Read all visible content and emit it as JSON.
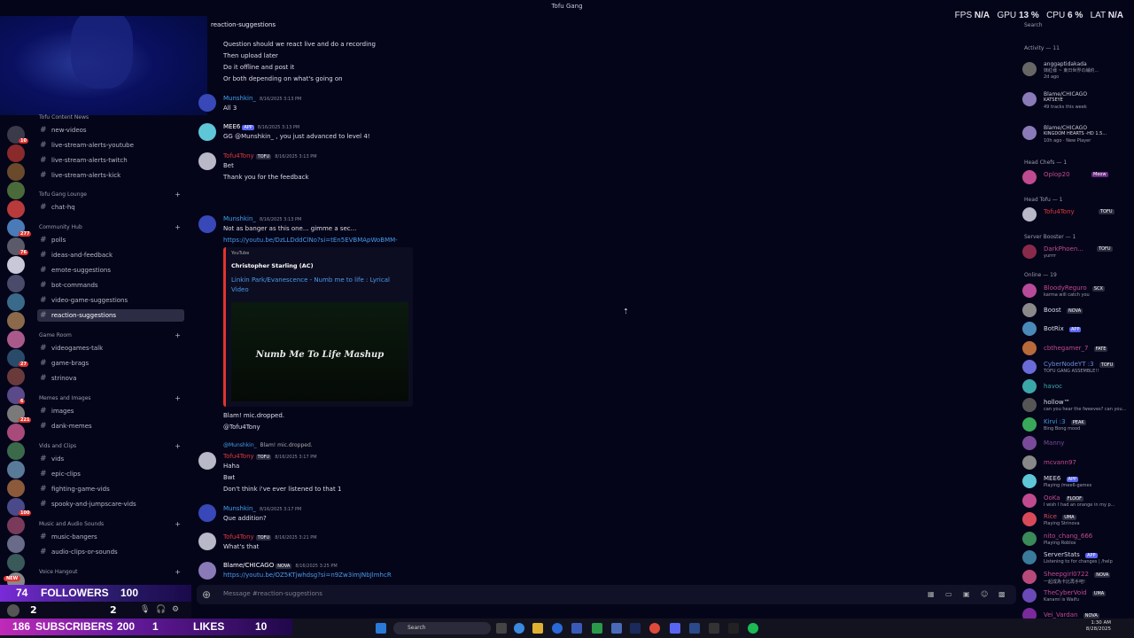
{
  "window": {
    "title": "Tofu Gang"
  },
  "perf": {
    "fps_label": "FPS",
    "fps": "N/A",
    "gpu_label": "GPU",
    "gpu": "13 %",
    "cpu_label": "CPU",
    "cpu": "6 %",
    "lat_label": "LAT",
    "lat": "N/A"
  },
  "search": {
    "placeholder": "Search"
  },
  "channel": {
    "title": "reaction-suggestions",
    "composer_placeholder": "Message #reaction-suggestions"
  },
  "categories": {
    "content_news": "Tofu Content News",
    "lounge": "Tofu Gang Lounge",
    "community": "Community Hub",
    "game_room": "Game Room",
    "memes": "Memes and Images",
    "vids": "Vids and Clips",
    "music": "Music and Audio Sounds",
    "voice": "Voice Hangout"
  },
  "channels": [
    "new-videos",
    "live-stream-alerts-youtube",
    "live-stream-alerts-twitch",
    "live-stream-alerts-kick",
    "chat-hq",
    "polls",
    "ideas-and-feedback",
    "emote-suggestions",
    "bot-commands",
    "video-game-suggestions",
    "reaction-suggestions",
    "videogames-talk",
    "game-brags",
    "strinova",
    "images",
    "dank-memes",
    "vids",
    "epic-clips",
    "fighting-game-vids",
    "spooky-and-jumpscare-vids",
    "music-bangers",
    "audio-clips-or-sounds"
  ],
  "server_badges": [
    "10",
    "",
    "",
    "",
    "",
    "277",
    "76",
    "",
    "",
    "",
    "",
    "",
    "27",
    "",
    "6",
    "221",
    "",
    "",
    "",
    "",
    "100",
    "",
    "",
    "",
    "19"
  ],
  "messages": {
    "pre1": "Question should we react live and do a recording",
    "pre2": "Then upload later",
    "pre3": "Do it offline and post it",
    "pre4": "Or both depending on what's going on",
    "m1_author": "Munshkin_",
    "m1_ts": "8/16/2025 3:13 PM",
    "m1_text": "All 3",
    "m2_author": "MEE6",
    "m2_tag": "APP",
    "m2_ts": "8/16/2025 3:13 PM",
    "m2_text1": "GG @Munshkin_",
    "m2_text2": ", you just advanced to level 4!",
    "m3_author": "Tofu4Tony",
    "m3_tag": "TOFU",
    "m3_ts": "8/16/2025 3:13 PM",
    "m3_text1": "Bet",
    "m3_text2": "Thank you for the feedback",
    "m4_author": "Munshkin_",
    "m4_ts": "8/16/2025 3:13 PM",
    "m4_text": "Not as banger as this one... gimme a sec...",
    "m4_link": "https://youtu.be/DzLLDddClNo?si=tEn5EVBMApWoBMM-",
    "embed_provider": "YouTube",
    "embed_author": "Christopher Starling (AC)",
    "embed_title": "Linkin Park/Evanescence - Numb me to life : Lyrical Video",
    "embed_video_text": "Numb Me To Life Mashup",
    "m4_text2": "Blam! mic.dropped.",
    "m4_text3": "@Tofu4Tony",
    "reply_author": "@Munshkin_",
    "reply_text": "Blam! mic.dropped.",
    "m5_author": "Tofu4Tony",
    "m5_tag": "TOFU",
    "m5_ts": "8/16/2025 3:17 PM",
    "m5_text1": "Haha",
    "m5_text2": "Bwt",
    "m5_text3": "Don't think i've ever listened to that 1",
    "m6_author": "Munshkin_",
    "m6_ts": "8/16/2025 3:17 PM",
    "m6_text": "Que addition?",
    "m7_author": "Tofu4Tony",
    "m7_tag": "TOFU",
    "m7_ts": "8/16/2025 3:21 PM",
    "m7_text": "What's that",
    "m8_author": "Blame/CHICAGO",
    "m8_tag": "NOVA",
    "m8_ts": "8/16/2025 3:25 PM",
    "m8_link": "https://youtu.be/OZ5KTjwhdsg?si=n9Zw3imJNbJlmhcR"
  },
  "members": {
    "activity_label": "Activity — 11",
    "act1_name": "anggaptidakada",
    "act1_sub": "妹紅様 ~ 東日世界の繊約...",
    "act1_time": "2d ago",
    "act2_name": "Blame/CHICAGO",
    "act2_sub": "KATSEYE",
    "act2_time": "49 tracks this week",
    "act3_name": "Blame/CHICAGO",
    "act3_sub": "KINGDOM HEARTS -HD 1.5...",
    "act3_time": "10h ago",
    "act3_extra": "New Player",
    "headchefs_label": "Head Chefs — 1",
    "hc1": "Oplop20",
    "hc1_tag": "Meow",
    "headtofu_label": "Head Tofu — 1",
    "ht1": "Tofu4Tony",
    "ht1_tag": "TOFU",
    "booster_label": "Server Booster — 1",
    "sb1": "DarkPhoen...",
    "sb1_tag": "TOFU",
    "sb1_status": "yurrrr",
    "online_label": "Online — 19",
    "online": [
      {
        "name": "BloodyReguro",
        "tag": "SCX",
        "status": "karma will catch you"
      },
      {
        "name": "Boost",
        "tag": "NOVA",
        "status": ""
      },
      {
        "name": "BotRix",
        "tag": "APP",
        "status": ""
      },
      {
        "name": "cbthegamer_7",
        "tag": "FATE",
        "status": ""
      },
      {
        "name": "CyberNodeYT :3",
        "tag": "TOFU",
        "status": "TOFU GANG ASSEMBLE!!"
      },
      {
        "name": "havoc",
        "tag": "",
        "status": ""
      },
      {
        "name": "hollow™",
        "tag": "",
        "status": "can you hear the fweeves? can you..."
      },
      {
        "name": "Kirvi :3",
        "tag": "PEAK",
        "status": "Bing Bong mood"
      },
      {
        "name": "Manny",
        "tag": "",
        "status": ""
      },
      {
        "name": "mcvann97",
        "tag": "",
        "status": ""
      },
      {
        "name": "MEE6",
        "tag": "APP",
        "status": "Playing /mee6-games"
      },
      {
        "name": "OoKa",
        "tag": "FLOOF",
        "status": "I wish I had an orange in my p..."
      },
      {
        "name": "Rice",
        "tag": "UMA",
        "status": "Playing Strinova"
      },
      {
        "name": "nito_chang_666",
        "tag": "",
        "status": "Playing Roblox"
      },
      {
        "name": "ServerStats",
        "tag": "APP",
        "status": "Listening to for changes | /help"
      },
      {
        "name": "Sheepgirl0722",
        "tag": "NOVA",
        "status": "一起成為卡比再手吧!"
      },
      {
        "name": "TheCyberVoid",
        "tag": "UMA",
        "status": "Kanami is Waifu"
      },
      {
        "name": "Vei_Vardan",
        "tag": "NOVA",
        "status": ""
      }
    ]
  },
  "overlay": {
    "followers_count": "74",
    "followers_label": "FOLLOWERS",
    "followers_goal": "100",
    "subs_count": "186",
    "subs_label": "SUBSCRIBERS",
    "subs_goal": "200",
    "likes_count": "1",
    "likes_label": "LIKES",
    "likes_goal": "10",
    "user_count1": "2",
    "user_count2": "2",
    "new_badge": "NEW"
  },
  "taskbar": {
    "search": "Search",
    "time": "1:30 AM",
    "date": "8/28/2025"
  }
}
